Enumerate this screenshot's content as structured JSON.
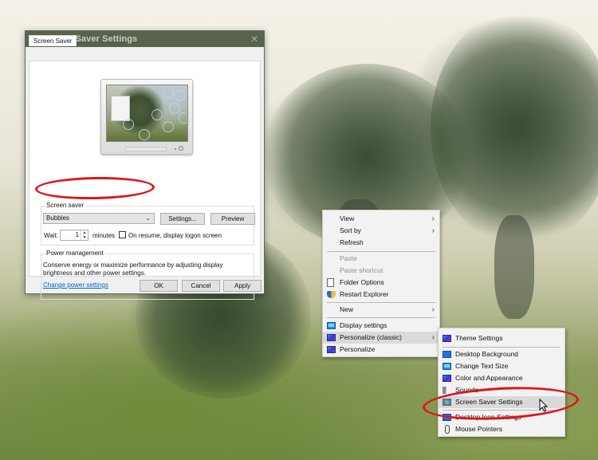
{
  "dialog": {
    "title": "Screen Saver Settings",
    "close_label": "✕",
    "tabs": [
      {
        "label": "Screen Saver",
        "active": true
      }
    ],
    "screen_saver_group": {
      "label": "Screen saver",
      "selected": "Bubbles",
      "settings_button": "Settings...",
      "preview_button": "Preview",
      "wait_label": "Wait:",
      "wait_value": "1",
      "minutes_label": "minutes",
      "logon_checkbox_label": "On resume, display logon screen",
      "logon_checked": false
    },
    "power_group": {
      "label": "Power management",
      "description": "Conserve energy or maximize performance by adjusting display brightness and other power settings.",
      "link": "Change power settings"
    },
    "buttons": {
      "ok": "OK",
      "cancel": "Cancel",
      "apply": "Apply"
    }
  },
  "context_menu": {
    "items": [
      {
        "label": "View",
        "submenu": true
      },
      {
        "label": "Sort by",
        "submenu": true
      },
      {
        "label": "Refresh"
      },
      {
        "label": "Paste",
        "disabled": true
      },
      {
        "label": "Paste shortcut",
        "disabled": true
      },
      {
        "label": "Folder Options",
        "icon": "document-icon"
      },
      {
        "label": "Restart Explorer",
        "icon": "shield-icon"
      },
      {
        "label": "New",
        "submenu": true
      },
      {
        "label": "Display settings",
        "icon": "display-icon"
      },
      {
        "label": "Personalize (classic)",
        "icon": "personalize-icon",
        "submenu": true,
        "highlighted": true
      },
      {
        "label": "Personalize",
        "icon": "personalize-icon"
      }
    ]
  },
  "sub_menu": {
    "items": [
      {
        "label": "Theme Settings",
        "icon": "personalize-icon"
      },
      {
        "label": "Desktop Background",
        "icon": "desktop-background-icon"
      },
      {
        "label": "Change Text Size",
        "icon": "display-icon"
      },
      {
        "label": "Color and Appearance",
        "icon": "personalize-icon"
      },
      {
        "label": "Sounds",
        "icon": "speaker-icon"
      },
      {
        "label": "Screen Saver Settings",
        "icon": "screen-saver-icon",
        "highlighted": true
      },
      {
        "label": "Desktop Icon Settings",
        "icon": "desktop-icon"
      },
      {
        "label": "Mouse Pointers",
        "icon": "mouse-icon"
      }
    ]
  },
  "annotations": {
    "color": "#e0141c"
  }
}
